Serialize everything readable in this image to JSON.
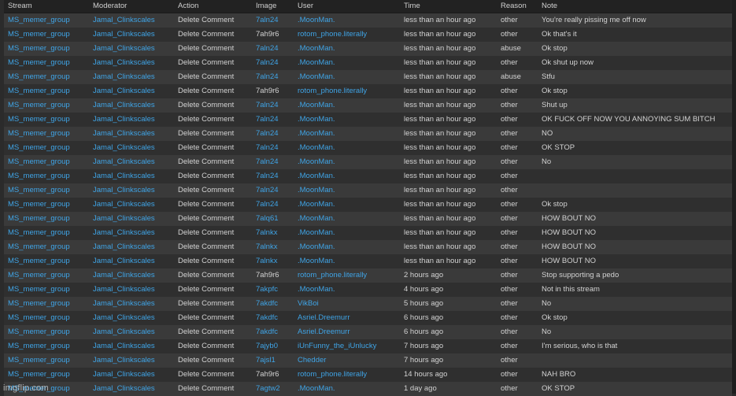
{
  "columns": [
    "Stream",
    "Moderator",
    "Action",
    "Image",
    "User",
    "Time",
    "Reason",
    "Note"
  ],
  "rows": [
    {
      "stream": "MS_memer_group",
      "moderator": "Jamal_Clinkscales",
      "action": "Delete Comment",
      "image": "7aln24",
      "user": ".MoonMan.",
      "time": "less than an hour ago",
      "reason": "other",
      "note": "You're really pissing me off now"
    },
    {
      "stream": "MS_memer_group",
      "moderator": "Jamal_Clinkscales",
      "action": "Delete Comment",
      "image": "7ah9r6",
      "user": "rotom_phone.literally",
      "time": "less than an hour ago",
      "reason": "other",
      "note": "Ok that's it"
    },
    {
      "stream": "MS_memer_group",
      "moderator": "Jamal_Clinkscales",
      "action": "Delete Comment",
      "image": "7aln24",
      "user": ".MoonMan.",
      "time": "less than an hour ago",
      "reason": "abuse",
      "note": "Ok stop"
    },
    {
      "stream": "MS_memer_group",
      "moderator": "Jamal_Clinkscales",
      "action": "Delete Comment",
      "image": "7aln24",
      "user": ".MoonMan.",
      "time": "less than an hour ago",
      "reason": "other",
      "note": "Ok shut up now"
    },
    {
      "stream": "MS_memer_group",
      "moderator": "Jamal_Clinkscales",
      "action": "Delete Comment",
      "image": "7aln24",
      "user": ".MoonMan.",
      "time": "less than an hour ago",
      "reason": "abuse",
      "note": "Stfu"
    },
    {
      "stream": "MS_memer_group",
      "moderator": "Jamal_Clinkscales",
      "action": "Delete Comment",
      "image": "7ah9r6",
      "user": "rotom_phone.literally",
      "time": "less than an hour ago",
      "reason": "other",
      "note": "Ok stop"
    },
    {
      "stream": "MS_memer_group",
      "moderator": "Jamal_Clinkscales",
      "action": "Delete Comment",
      "image": "7aln24",
      "user": ".MoonMan.",
      "time": "less than an hour ago",
      "reason": "other",
      "note": "Shut up"
    },
    {
      "stream": "MS_memer_group",
      "moderator": "Jamal_Clinkscales",
      "action": "Delete Comment",
      "image": "7aln24",
      "user": ".MoonMan.",
      "time": "less than an hour ago",
      "reason": "other",
      "note": "OK FUCK OFF NOW YOU ANNOYING SUM BITCH"
    },
    {
      "stream": "MS_memer_group",
      "moderator": "Jamal_Clinkscales",
      "action": "Delete Comment",
      "image": "7aln24",
      "user": ".MoonMan.",
      "time": "less than an hour ago",
      "reason": "other",
      "note": "NO"
    },
    {
      "stream": "MS_memer_group",
      "moderator": "Jamal_Clinkscales",
      "action": "Delete Comment",
      "image": "7aln24",
      "user": ".MoonMan.",
      "time": "less than an hour ago",
      "reason": "other",
      "note": "OK STOP"
    },
    {
      "stream": "MS_memer_group",
      "moderator": "Jamal_Clinkscales",
      "action": "Delete Comment",
      "image": "7aln24",
      "user": ".MoonMan.",
      "time": "less than an hour ago",
      "reason": "other",
      "note": "No"
    },
    {
      "stream": "MS_memer_group",
      "moderator": "Jamal_Clinkscales",
      "action": "Delete Comment",
      "image": "7aln24",
      "user": ".MoonMan.",
      "time": "less than an hour ago",
      "reason": "other",
      "note": ""
    },
    {
      "stream": "MS_memer_group",
      "moderator": "Jamal_Clinkscales",
      "action": "Delete Comment",
      "image": "7aln24",
      "user": ".MoonMan.",
      "time": "less than an hour ago",
      "reason": "other",
      "note": ""
    },
    {
      "stream": "MS_memer_group",
      "moderator": "Jamal_Clinkscales",
      "action": "Delete Comment",
      "image": "7aln24",
      "user": ".MoonMan.",
      "time": "less than an hour ago",
      "reason": "other",
      "note": "Ok stop"
    },
    {
      "stream": "MS_memer_group",
      "moderator": "Jamal_Clinkscales",
      "action": "Delete Comment",
      "image": "7alq61",
      "user": ".MoonMan.",
      "time": "less than an hour ago",
      "reason": "other",
      "note": "HOW BOUT NO"
    },
    {
      "stream": "MS_memer_group",
      "moderator": "Jamal_Clinkscales",
      "action": "Delete Comment",
      "image": "7alnkx",
      "user": ".MoonMan.",
      "time": "less than an hour ago",
      "reason": "other",
      "note": "HOW BOUT NO"
    },
    {
      "stream": "MS_memer_group",
      "moderator": "Jamal_Clinkscales",
      "action": "Delete Comment",
      "image": "7alnkx",
      "user": ".MoonMan.",
      "time": "less than an hour ago",
      "reason": "other",
      "note": "HOW BOUT NO"
    },
    {
      "stream": "MS_memer_group",
      "moderator": "Jamal_Clinkscales",
      "action": "Delete Comment",
      "image": "7alnkx",
      "user": ".MoonMan.",
      "time": "less than an hour ago",
      "reason": "other",
      "note": "HOW BOUT NO"
    },
    {
      "stream": "MS_memer_group",
      "moderator": "Jamal_Clinkscales",
      "action": "Delete Comment",
      "image": "7ah9r6",
      "user": "rotom_phone.literally",
      "time": "2 hours ago",
      "reason": "other",
      "note": "Stop supporting a pedo"
    },
    {
      "stream": "MS_memer_group",
      "moderator": "Jamal_Clinkscales",
      "action": "Delete Comment",
      "image": "7akpfc",
      "user": ".MoonMan.",
      "time": "4 hours ago",
      "reason": "other",
      "note": "Not in this stream"
    },
    {
      "stream": "MS_memer_group",
      "moderator": "Jamal_Clinkscales",
      "action": "Delete Comment",
      "image": "7akdfc",
      "user": "VikBoi",
      "time": "5 hours ago",
      "reason": "other",
      "note": "No"
    },
    {
      "stream": "MS_memer_group",
      "moderator": "Jamal_Clinkscales",
      "action": "Delete Comment",
      "image": "7akdfc",
      "user": "Asriel.Dreemurr",
      "time": "6 hours ago",
      "reason": "other",
      "note": "Ok stop"
    },
    {
      "stream": "MS_memer_group",
      "moderator": "Jamal_Clinkscales",
      "action": "Delete Comment",
      "image": "7akdfc",
      "user": "Asriel.Dreemurr",
      "time": "6 hours ago",
      "reason": "other",
      "note": "No"
    },
    {
      "stream": "MS_memer_group",
      "moderator": "Jamal_Clinkscales",
      "action": "Delete Comment",
      "image": "7ajyb0",
      "user": "iUnFunny_the_iUnlucky",
      "time": "7 hours ago",
      "reason": "other",
      "note": "I'm serious, who is that"
    },
    {
      "stream": "MS_memer_group",
      "moderator": "Jamal_Clinkscales",
      "action": "Delete Comment",
      "image": "7ajsl1",
      "user": "Chedder",
      "time": "7 hours ago",
      "reason": "other",
      "note": ""
    },
    {
      "stream": "MS_memer_group",
      "moderator": "Jamal_Clinkscales",
      "action": "Delete Comment",
      "image": "7ah9r6",
      "user": "rotom_phone.literally",
      "time": "14 hours ago",
      "reason": "other",
      "note": "NAH BRO"
    },
    {
      "stream": "MS_memer_group",
      "moderator": "Jamal_Clinkscales",
      "action": "Delete Comment",
      "image": "7agtw2",
      "user": ".MoonMan.",
      "time": "1 day ago",
      "reason": "other",
      "note": "OK STOP"
    }
  ],
  "watermark": "imgflip.com",
  "colors": {
    "link": "#3fa4e6",
    "text": "#d2d2d2",
    "row_odd": "#3a3a3a",
    "row_even": "#2f2f2f"
  }
}
